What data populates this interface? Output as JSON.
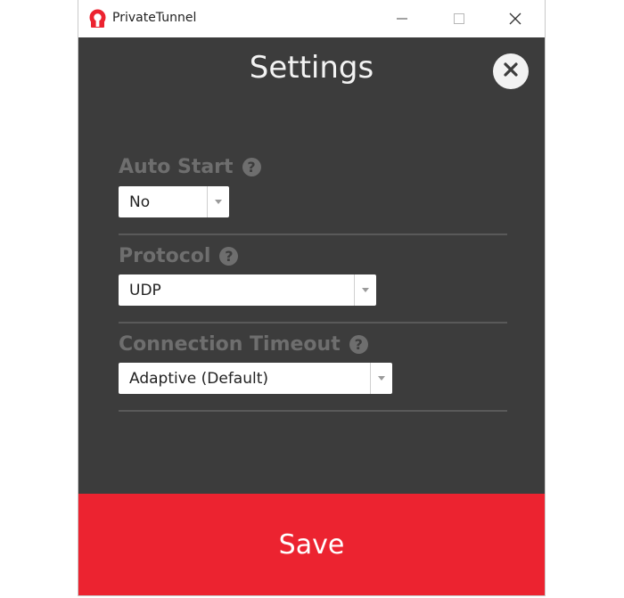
{
  "window": {
    "app_title": "PrivateTunnel",
    "colors": {
      "background": "#3c3c3c",
      "accent": "#ec2330",
      "label": "#6e6e6e"
    }
  },
  "settings": {
    "title": "Settings",
    "close_icon": "close-icon",
    "fields": [
      {
        "label": "Auto Start",
        "help_icon": "question-icon",
        "value": "No"
      },
      {
        "label": "Protocol",
        "help_icon": "question-icon",
        "value": "UDP"
      },
      {
        "label": "Connection Timeout",
        "help_icon": "question-icon",
        "value": "Adaptive (Default)"
      }
    ]
  },
  "footer": {
    "save_label": "Save"
  }
}
